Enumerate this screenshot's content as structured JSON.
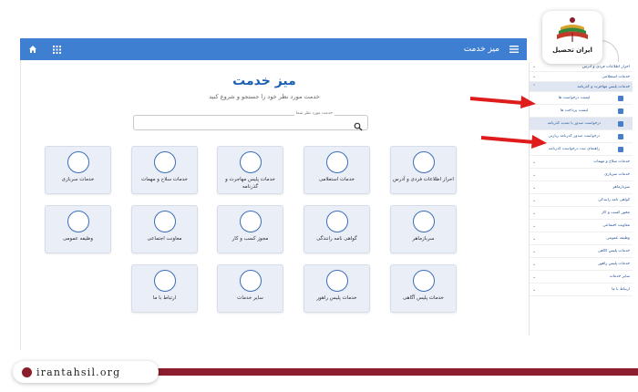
{
  "header": {
    "title": "میز خدمت",
    "menu_icon": "hamburger-icon",
    "home_icon": "home-icon",
    "grid_icon": "grid-icon"
  },
  "main": {
    "title": "میز خدمت",
    "subtitle": "خدمت مورد نظر خود را جستجو و شروع کنید",
    "search": {
      "label": "خدمت مورد نظر شما",
      "value": ""
    },
    "cards": [
      {
        "label": "احراز اطلاعات فردی و آدرس"
      },
      {
        "label": "خدمات استعلامی"
      },
      {
        "label": "خدمات پلیس مهاجرت و گذرنامه"
      },
      {
        "label": "خدمات سلاح و مهمات"
      },
      {
        "label": "خدمات سربازی"
      },
      {
        "label": "سربازماهر"
      },
      {
        "label": "گواهی نامه رانندگی"
      },
      {
        "label": "مجوز کسب و کار"
      },
      {
        "label": "معاونت اجتماعی"
      },
      {
        "label": "وظیفه عمومی"
      },
      {
        "label": "خدمات پلیس آگاهی"
      },
      {
        "label": "خدمات پلیس راهور"
      },
      {
        "label": "سایر خدمات"
      },
      {
        "label": "ارتباط با ما"
      }
    ]
  },
  "sidebar": {
    "items": [
      {
        "label": "احراز اطلاعات فردی و آدرس"
      },
      {
        "label": "خدمات استعلامی"
      },
      {
        "label": "خدمات پلیس مهاجرت و گذرنامه"
      },
      {
        "label": "لیست درخواست ها"
      },
      {
        "label": "لیست پرداخت ها"
      },
      {
        "label": "درخواست صدور یا تمدید گذرنامه"
      },
      {
        "label": "درخواست صدور گذرنامه زیارتی"
      },
      {
        "label": "راهنمای ثبت درخواست گذرنامه"
      },
      {
        "label": "خدمات سلاح و مهمات"
      },
      {
        "label": "خدمات سربازی"
      },
      {
        "label": "سربازماهر"
      },
      {
        "label": "گواهی نامه رانندگی"
      },
      {
        "label": "مجوز کسب و کار"
      },
      {
        "label": "معاونت اجتماعی"
      },
      {
        "label": "وظیفه عمومی"
      },
      {
        "label": "خدمات پلیس آگاهی"
      },
      {
        "label": "خدمات پلیس راهور"
      },
      {
        "label": "سایر خدمات"
      },
      {
        "label": "ارتباط با ما"
      }
    ]
  },
  "logo": {
    "text": "ایران تحصیل"
  },
  "footer": {
    "url": "irantahsil.org"
  },
  "colors": {
    "accent": "#3f7fd1",
    "brand": "#8b1d2c",
    "arrow": "#e01b1b",
    "card_bg": "#e9eef7"
  }
}
